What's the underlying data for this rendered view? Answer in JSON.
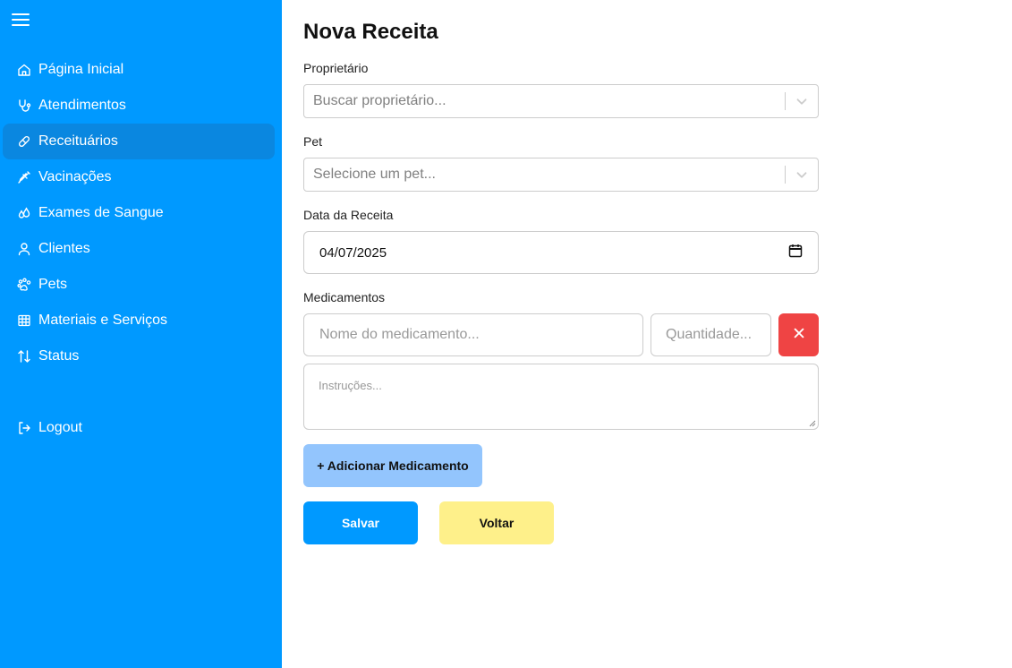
{
  "sidebar": {
    "menu_icon": "hamburger-icon",
    "items": [
      {
        "label": "Página Inicial",
        "icon": "home-icon",
        "active": false
      },
      {
        "label": "Atendimentos",
        "icon": "stethoscope-icon",
        "active": false
      },
      {
        "label": "Receituários",
        "icon": "pill-icon",
        "active": true
      },
      {
        "label": "Vacinações",
        "icon": "syringe-icon",
        "active": false
      },
      {
        "label": "Exames de Sangue",
        "icon": "droplets-icon",
        "active": false
      },
      {
        "label": "Clientes",
        "icon": "user-icon",
        "active": false
      },
      {
        "label": "Pets",
        "icon": "paw-icon",
        "active": false
      },
      {
        "label": "Materiais e Serviços",
        "icon": "table-icon",
        "active": false
      },
      {
        "label": "Status",
        "icon": "arrows-updown-icon",
        "active": false
      }
    ],
    "logout": {
      "label": "Logout",
      "icon": "logout-icon"
    },
    "colors": {
      "background": "#0099ff",
      "active": "#0a87e0"
    }
  },
  "form": {
    "title": "Nova Receita",
    "owner": {
      "label": "Proprietário",
      "placeholder": "Buscar proprietário..."
    },
    "pet": {
      "label": "Pet",
      "placeholder": "Selecione um pet..."
    },
    "date": {
      "label": "Data da Receita",
      "value": "04/07/2025"
    },
    "medications": {
      "label": "Medicamentos",
      "name_placeholder": "Nome do medicamento...",
      "quantity_placeholder": "Quantidade...",
      "instructions_placeholder": "Instruções..."
    },
    "add_button": "+ Adicionar Medicamento",
    "save_button": "Salvar",
    "back_button": "Voltar",
    "colors": {
      "remove": "#ef4444",
      "add": "#93c5fd",
      "save": "#0099ff",
      "back": "#fef08a"
    }
  }
}
